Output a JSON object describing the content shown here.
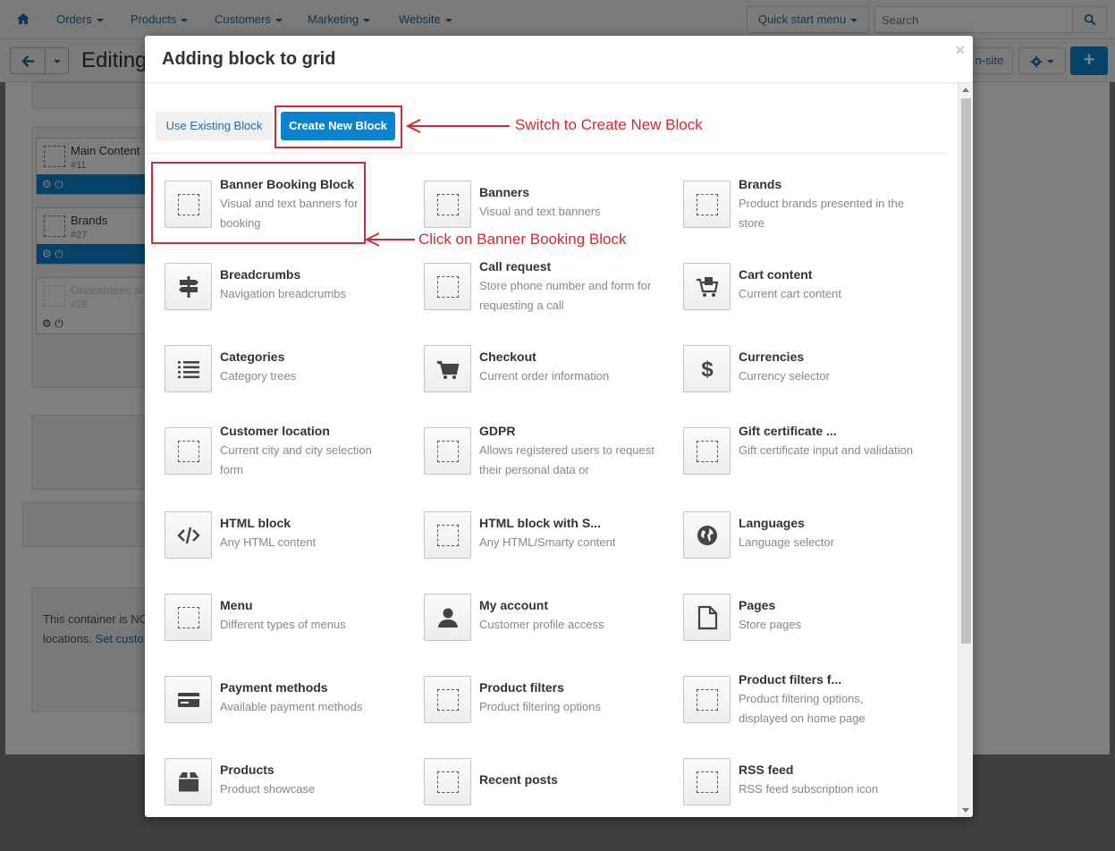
{
  "nav": {
    "items": [
      "Orders",
      "Products",
      "Customers",
      "Marketing",
      "Website"
    ],
    "quick_start": "Quick start menu",
    "search_placeholder": "Search"
  },
  "toolbar": {
    "title": "Editing",
    "onsite_label": "n-site"
  },
  "background": {
    "blocks": [
      {
        "name": "Main Content",
        "id": "#11"
      },
      {
        "name": "Brands",
        "id": "#27"
      },
      {
        "name": "Guarantees sh",
        "id": "#28"
      }
    ],
    "note_line1": "This container is NO",
    "note_line2_prefix": "locations.",
    "note_link": "Set custo"
  },
  "modal": {
    "title": "Adding block to grid",
    "close": "×",
    "tabs": {
      "existing": "Use Existing Block",
      "new": "Create New Block"
    },
    "blocks": [
      {
        "name": "Banner Booking Block",
        "desc": "Visual and text banners for booking",
        "icon": "dotted-square-icon"
      },
      {
        "name": "Banners",
        "desc": "Visual and text banners",
        "icon": "dotted-square-icon"
      },
      {
        "name": "Brands",
        "desc": "Product brands presented in the store",
        "icon": "dotted-square-icon"
      },
      {
        "name": "Breadcrumbs",
        "desc": "Navigation breadcrumbs",
        "icon": "signpost-icon"
      },
      {
        "name": "Call request",
        "desc": "Store phone number and form for requesting a call",
        "icon": "dotted-square-icon"
      },
      {
        "name": "Cart content",
        "desc": "Current cart content",
        "icon": "cart-content-icon"
      },
      {
        "name": "Categories",
        "desc": "Category trees",
        "icon": "list-icon"
      },
      {
        "name": "Checkout",
        "desc": "Current order information",
        "icon": "cart-icon"
      },
      {
        "name": "Currencies",
        "desc": "Currency selector",
        "icon": "dollar-icon"
      },
      {
        "name": "Customer location",
        "desc": "Current city and city selection form",
        "icon": "dotted-square-icon"
      },
      {
        "name": "GDPR",
        "desc": "Allows registered users to request their personal data or",
        "icon": "dotted-square-icon"
      },
      {
        "name": "Gift certificate ...",
        "desc": "Gift certificate input and validation",
        "icon": "dotted-square-icon"
      },
      {
        "name": "HTML block",
        "desc": "Any HTML content",
        "icon": "code-icon"
      },
      {
        "name": "HTML block with S...",
        "desc": "Any HTML/Smarty content",
        "icon": "dotted-square-icon"
      },
      {
        "name": "Languages",
        "desc": "Language selector",
        "icon": "globe-icon"
      },
      {
        "name": "Menu",
        "desc": "Different types of menus",
        "icon": "dotted-square-icon"
      },
      {
        "name": "My account",
        "desc": "Customer profile access",
        "icon": "user-icon"
      },
      {
        "name": "Pages",
        "desc": "Store pages",
        "icon": "page-icon"
      },
      {
        "name": "Payment methods",
        "desc": "Available payment methods",
        "icon": "credit-card-icon"
      },
      {
        "name": "Product filters",
        "desc": "Product filtering options",
        "icon": "dotted-square-icon"
      },
      {
        "name": "Product filters f...",
        "desc": "Product filtering options, displayed on home page",
        "icon": "dotted-square-icon"
      },
      {
        "name": "Products",
        "desc": "Product showcase",
        "icon": "box-icon"
      },
      {
        "name": "Recent posts",
        "desc": "",
        "icon": "dotted-square-icon"
      },
      {
        "name": "RSS feed",
        "desc": "RSS feed subscription icon",
        "icon": "dotted-square-icon"
      }
    ]
  },
  "annotations": {
    "switch": "Switch to Create New Block",
    "click": "Click on Banner Booking Block",
    "color": "#d9262f"
  },
  "colors": {
    "primary": "#0b84d0",
    "link": "#1d6fa5"
  }
}
